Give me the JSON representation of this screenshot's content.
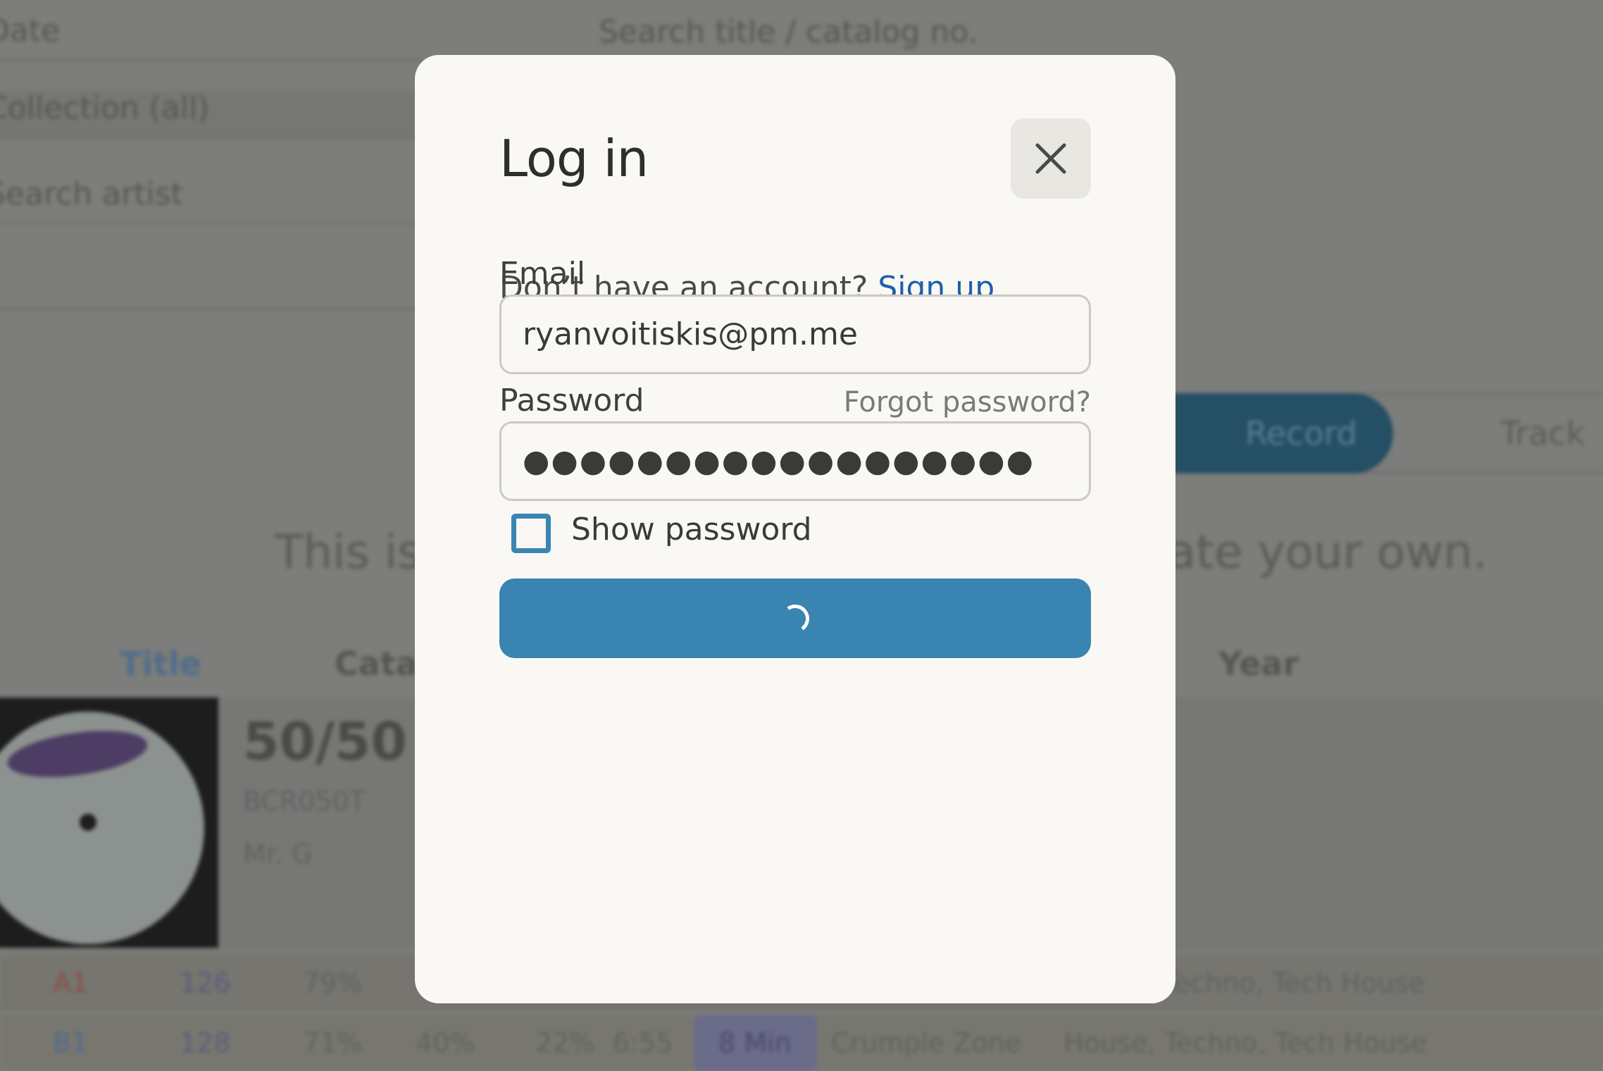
{
  "background": {
    "filters": {
      "date": "Date",
      "collection": "Collection (all)",
      "artist_search": "Search artist",
      "title_search": "Search title / catalog no."
    },
    "view_toggle": {
      "active": "Record",
      "inactive": "Track"
    },
    "notice": "This is a demo collection. Log in to create your own.",
    "columns": {
      "title": "Title",
      "catalog": "Catalog",
      "year": "Year"
    },
    "record": {
      "title": "50/50 EP",
      "catalog": "BCR050T",
      "artist": "Mr. G"
    },
    "tracks": [
      {
        "position": "A1",
        "bpm": "126",
        "energy": "79%",
        "genres": "Techno, Tech House"
      },
      {
        "position": "B1",
        "bpm": "128",
        "energy": "71%",
        "key_pct": "40%",
        "mood_pct": "22%",
        "duration": "6:55",
        "key": "8 Min",
        "label": "Crumple Zone",
        "genres": "House, Techno, Tech House"
      }
    ]
  },
  "login": {
    "title": "Log in",
    "close_icon": "close-icon",
    "signup_prompt": "Don’t have an account?",
    "signup_link": "Sign up",
    "email_label": "Email",
    "email_value": "ryanvoitiskis@pm.me",
    "password_label": "Password",
    "forgot_password": "Forgot password?",
    "password_value": "●●●●●●●●●●●●●●●●●●",
    "show_password_label": "Show password",
    "show_password_checked": false,
    "submit_state": "loading"
  },
  "colors": {
    "accent": "#3984b1",
    "link": "#1f5fa8",
    "modal_bg": "#f9f8f5",
    "overlay": "#7d7d7b"
  }
}
